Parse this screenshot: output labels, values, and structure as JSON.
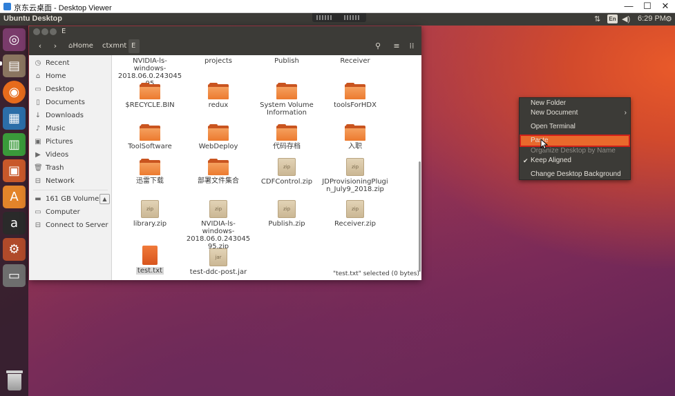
{
  "viewer": {
    "title": "京东云桌面 - Desktop Viewer",
    "minimize": "—",
    "maximize": "☐",
    "close": "✕"
  },
  "panel": {
    "title": "Ubuntu Desktop",
    "keyboard_layout": "En",
    "time": "6:29 PM",
    "icons": [
      "network-icon",
      "keyboard-icon",
      "volume-icon",
      "settings-icon"
    ]
  },
  "launcher": {
    "items": [
      {
        "name": "ubuntu-dash-icon",
        "glyph": "◎"
      },
      {
        "name": "files-icon",
        "glyph": "▤"
      },
      {
        "name": "firefox-icon",
        "glyph": "◉"
      },
      {
        "name": "writer-icon",
        "glyph": "▦"
      },
      {
        "name": "calc-icon",
        "glyph": "▥"
      },
      {
        "name": "impress-icon",
        "glyph": "▣"
      },
      {
        "name": "software-center-icon",
        "glyph": "A"
      },
      {
        "name": "amazon-icon",
        "glyph": "a"
      },
      {
        "name": "system-settings-icon",
        "glyph": "⚙"
      },
      {
        "name": "drive-icon",
        "glyph": "▭"
      }
    ],
    "trash_name": "trash-icon"
  },
  "file_manager": {
    "window_title": "E",
    "breadcrumbs": [
      "Home",
      "ctxmnt",
      "E"
    ],
    "sidebar": [
      {
        "icon": "recent-icon",
        "glyph": "◷",
        "label": "Recent"
      },
      {
        "icon": "home-icon",
        "glyph": "⌂",
        "label": "Home"
      },
      {
        "icon": "desktop-icon",
        "glyph": "▭",
        "label": "Desktop"
      },
      {
        "icon": "documents-icon",
        "glyph": "▯",
        "label": "Documents"
      },
      {
        "icon": "downloads-icon",
        "glyph": "↓",
        "label": "Downloads"
      },
      {
        "icon": "music-icon",
        "glyph": "♪",
        "label": "Music"
      },
      {
        "icon": "pictures-icon",
        "glyph": "▣",
        "label": "Pictures"
      },
      {
        "icon": "videos-icon",
        "glyph": "▶",
        "label": "Videos"
      },
      {
        "icon": "trash-icon",
        "glyph": "🗑",
        "label": "Trash"
      },
      {
        "icon": "network-icon",
        "glyph": "⊟",
        "label": "Network"
      },
      {
        "icon": "volume-icon",
        "glyph": "▬",
        "label": "161 GB Volume"
      },
      {
        "icon": "computer-icon",
        "glyph": "▭",
        "label": "Computer"
      },
      {
        "icon": "connect-server-icon",
        "glyph": "⊟",
        "label": "Connect to Server"
      }
    ],
    "files": [
      {
        "type": "partial",
        "name": "NVIDIA-ls-windows-2018.06.0.24304595"
      },
      {
        "type": "partial",
        "name": "projects"
      },
      {
        "type": "partial",
        "name": "Publish"
      },
      {
        "type": "partial",
        "name": "Receiver"
      },
      {
        "type": "folder",
        "name": "$RECYCLE.BIN"
      },
      {
        "type": "folder",
        "name": "redux"
      },
      {
        "type": "folder",
        "name": "System Volume Information"
      },
      {
        "type": "folder",
        "name": "toolsForHDX"
      },
      {
        "type": "folder",
        "name": "ToolSoftware"
      },
      {
        "type": "folder",
        "name": "WebDeploy"
      },
      {
        "type": "folder",
        "name": "代码存档"
      },
      {
        "type": "folder",
        "name": "入职"
      },
      {
        "type": "folder",
        "name": "迅雷下载"
      },
      {
        "type": "folder",
        "name": "部署文件集合"
      },
      {
        "type": "zip",
        "name": "CDFControl.zip",
        "badge": "zip"
      },
      {
        "type": "zip",
        "name": "JDProvisioningPlugin_July9_2018.zip",
        "badge": "zip"
      },
      {
        "type": "zip",
        "name": "library.zip",
        "badge": "zip"
      },
      {
        "type": "zip",
        "name": "NVIDIA-ls-windows-2018.06.0.24304595.zip",
        "badge": "zip"
      },
      {
        "type": "zip",
        "name": "Publish.zip",
        "badge": "zip"
      },
      {
        "type": "zip",
        "name": "Receiver.zip",
        "badge": "zip"
      },
      {
        "type": "txt",
        "name": "test.txt",
        "selected": true
      },
      {
        "type": "zip",
        "name": "test-ddc-post.jar",
        "badge": "jar"
      }
    ],
    "status": "\"test.txt\" selected  (0 bytes)"
  },
  "context_menu": {
    "items": [
      {
        "label": "New Folder",
        "submenu": false
      },
      {
        "label": "New Document",
        "submenu": true
      },
      {
        "label": "Open Terminal",
        "submenu": false
      },
      {
        "label": "Paste",
        "highlighted": true
      },
      {
        "label": "Organize Desktop by Name",
        "dim": true
      },
      {
        "label": "Keep Aligned",
        "checked": true
      },
      {
        "label": "Change Desktop Background"
      }
    ]
  }
}
